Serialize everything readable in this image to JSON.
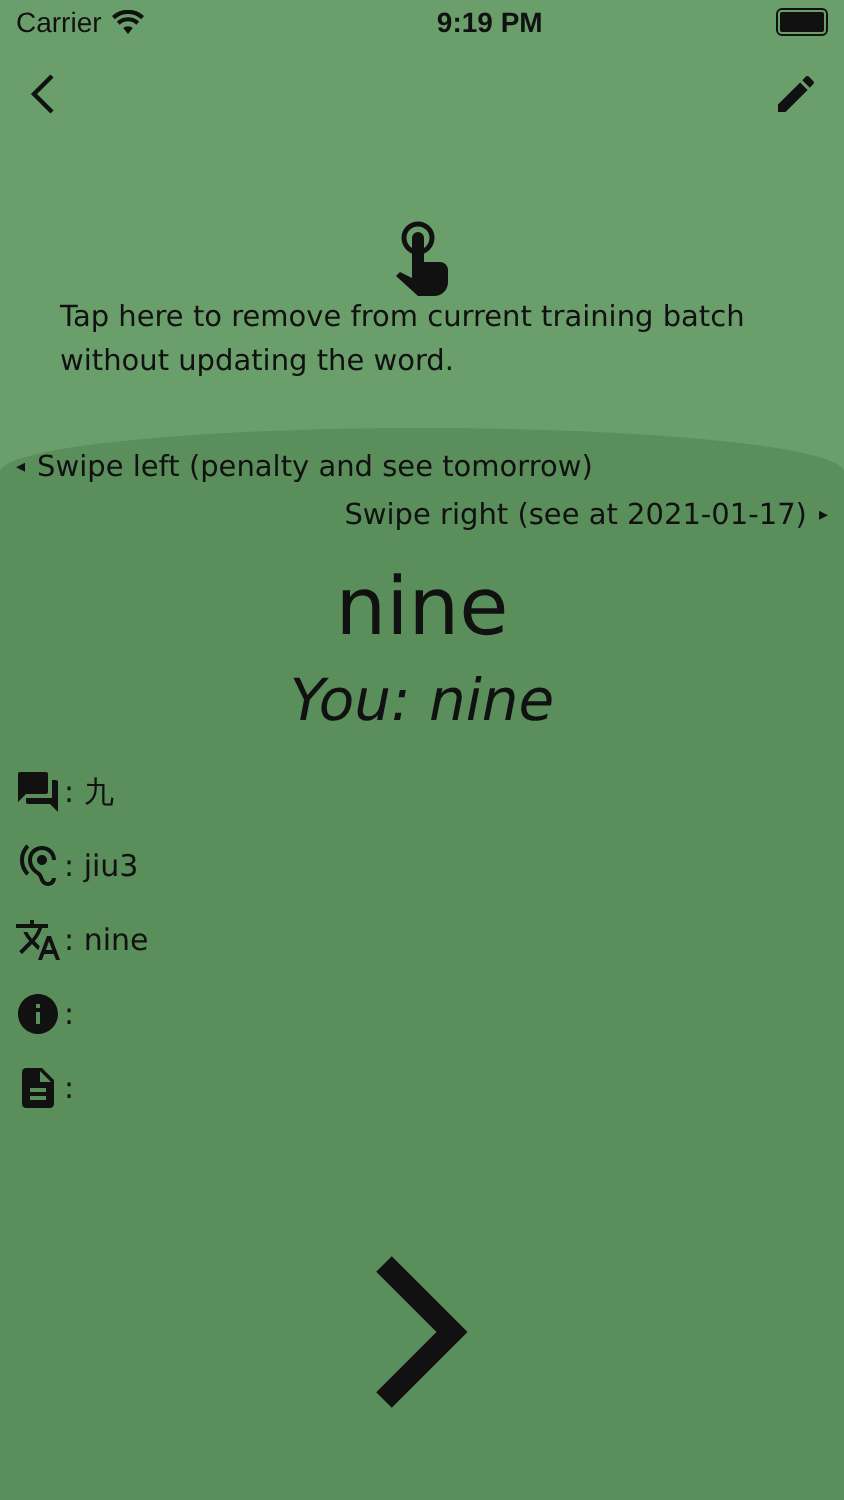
{
  "status_bar": {
    "carrier": "Carrier",
    "time": "9:19 PM"
  },
  "hint": {
    "text": "Tap here to remove from current training batch without updating the word."
  },
  "swipe_left": {
    "arrow": "◂",
    "label": "Swipe left (penalty and see tomorrow)"
  },
  "swipe_right": {
    "arrow": "▸",
    "label": "Swipe right (see at 2021-01-17)"
  },
  "word": "nine",
  "answer": "You: nine",
  "details": [
    {
      "kind": "chat",
      "value": ": 九"
    },
    {
      "kind": "hearing",
      "value": ": jiu3"
    },
    {
      "kind": "translate",
      "value": ": nine"
    },
    {
      "kind": "info",
      "value": ":"
    },
    {
      "kind": "note",
      "value": ":"
    }
  ]
}
